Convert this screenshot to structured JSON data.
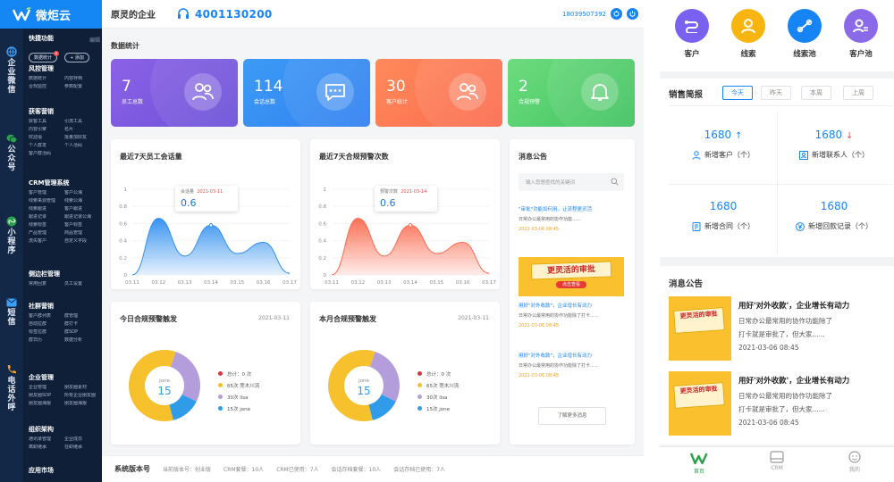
{
  "app": {
    "name": "微炬云"
  },
  "rail": [
    {
      "label": "企业微信",
      "icon": "globe-icon",
      "color": "#3aa0ff"
    },
    {
      "label": "公众号",
      "icon": "wechat-icon",
      "color": "#2aa04a"
    },
    {
      "label": "小程序",
      "icon": "mini-program-icon",
      "color": "#2aa04a"
    },
    {
      "label": "短信",
      "icon": "sms-icon",
      "color": "#3aa0ff"
    },
    {
      "label": "电话外呼",
      "icon": "phone-icon",
      "color": "#f2a118"
    }
  ],
  "sidebar": {
    "quick": {
      "title": "快捷功能",
      "edit": "编辑",
      "pills": [
        "数据统计",
        "+ 添加"
      ]
    },
    "groups": [
      {
        "title": "风控管理",
        "items": [
          "数据统计",
          "内容存档",
          "合规监控",
          "参数配置"
        ]
      },
      {
        "title": "获客营销",
        "items": [
          "获客工具",
          "引流工具",
          "内容引擎",
          "名片",
          "欢迎语",
          "批量加好友",
          "个人群发",
          "个人活码",
          "客户群活码"
        ]
      },
      {
        "title": "CRM管理系统",
        "items": [
          "客户管理",
          "客户公海",
          "线索来源管理",
          "线索公海",
          "线索跟进",
          "客户跟进",
          "跟进记录",
          "跟进记录公海",
          "线索标签",
          "客户标签",
          "产品管理",
          "商品管理",
          "流失客户",
          "自定义字段"
        ]
      },
      {
        "title": "侧边栏管理",
        "items": [
          "常用回复",
          "员工设置"
        ]
      },
      {
        "title": "社群营销",
        "items": [
          "客户群列表",
          "群管理",
          "自动拉群",
          "群打卡",
          "标签拉群",
          "群SOP",
          "群日历",
          "数据分析"
        ]
      },
      {
        "title": "企业管理",
        "items": [
          "企业管理",
          "朋友圈素材",
          "朋友圈SOP",
          "所有企业朋友圈",
          "朋友圈海报",
          "朋友圈海报"
        ]
      },
      {
        "title": "组织架构",
        "items": [
          "通讯录管理",
          "企业成员",
          "离职继承",
          "在职继承"
        ]
      },
      {
        "title": "应用市场",
        "items": []
      }
    ]
  },
  "topbar": {
    "company": "原灵的企业",
    "phone": "4001130200",
    "account": "18039507392"
  },
  "main": {
    "section_title": "数据统计",
    "stats": [
      {
        "value": "7",
        "label": "员工总数",
        "icon": "people-icon",
        "from": "#8c62e6",
        "to": "#6a4fd8"
      },
      {
        "value": "114",
        "label": "会话总数",
        "icon": "chat-icon",
        "from": "#3d9bf5",
        "to": "#2f7ff0"
      },
      {
        "value": "30",
        "label": "客户统计",
        "icon": "people-icon",
        "from": "#ff8a5b",
        "to": "#fb6a4e"
      },
      {
        "value": "2",
        "label": "合规预警",
        "icon": "bell-icon",
        "from": "#6edc7f",
        "to": "#3fc25f"
      }
    ],
    "chart1": {
      "title": "最近7天员工会话量",
      "tooltip_label": "会话量",
      "tooltip_date": "2021-03-11",
      "tooltip_value": "0.6"
    },
    "chart2": {
      "title": "最近7天合规预警次数",
      "tooltip_label": "预警次数",
      "tooltip_date": "2021-03-14",
      "tooltip_value": "0.6"
    },
    "donut1": {
      "title": "今日合规预警触发",
      "date": "2021-03-11",
      "center_name": "jone",
      "center_value": "15"
    },
    "donut2": {
      "title": "本月合规预警触发",
      "date": "2021-03-11",
      "center_name": "jone",
      "center_value": "15"
    },
    "donut_legend": [
      {
        "text": "总计：0 次",
        "color": "#d9363e"
      },
      {
        "text": "65次 莞木川流",
        "color": "#f7c02d"
      },
      {
        "text": "30次 lisa",
        "color": "#b39ddb"
      },
      {
        "text": "15次 jone",
        "color": "#2f9be9"
      }
    ],
    "notice": {
      "title": "消息公告",
      "search_placeholder": "输入您想查找的关键词",
      "news1_title": "\"审批\"功能如何用，让流程更灵活",
      "news1_desc": "日常办公最常用的协作功能......",
      "news1_date": "2021-03-06 08:45",
      "banner_text": "更灵活的审批",
      "banner_sub": "点击查看",
      "news2_title": "用好\"对外收款\"，企业增长有动力",
      "news2_desc": "日常办公最常用的协作功能除了打卡......",
      "news2_date": "2021-03-06 08:45",
      "news3_title": "用好\"对外收款\"，企业增长有动力",
      "news3_desc": "日常办公最常用的协作功能除了打卡......",
      "news3_date": "2021-03-06 08:45",
      "more": "了解更多消息"
    }
  },
  "chart_data": [
    {
      "type": "area",
      "title": "最近7天员工会话量",
      "categories": [
        "03.11",
        "03.12",
        "03.13",
        "03.14",
        "03.15",
        "03.16",
        "03.17"
      ],
      "series": [
        {
          "name": "会话量",
          "values": [
            0.0,
            0.66,
            0.22,
            0.58,
            0.25,
            0.38,
            0.02
          ]
        }
      ],
      "ylim": [
        0,
        1
      ],
      "yticks": [
        "0",
        "0.2",
        "0.4",
        "0.6",
        "0.8",
        "1"
      ],
      "color": "#2f8ef0"
    },
    {
      "type": "area",
      "title": "最近7天合规预警次数",
      "categories": [
        "03.11",
        "03.12",
        "03.13",
        "03.14",
        "03.15",
        "03.16",
        "03.17"
      ],
      "series": [
        {
          "name": "预警次数",
          "values": [
            0.0,
            0.66,
            0.22,
            0.58,
            0.25,
            0.38,
            0.02
          ]
        }
      ],
      "ylim": [
        0,
        1
      ],
      "yticks": [
        "0",
        "0.2",
        "0.4",
        "0.6",
        "0.8",
        "1"
      ],
      "color": "#fb6a4e"
    },
    {
      "type": "pie",
      "title": "今日合规预警触发",
      "categories": [
        "莞木川流",
        "lisa",
        "jone"
      ],
      "values": [
        65,
        30,
        15
      ]
    },
    {
      "type": "pie",
      "title": "本月合规预警触发",
      "categories": [
        "莞木川流",
        "lisa",
        "jone"
      ],
      "values": [
        65,
        30,
        15
      ]
    }
  ],
  "bottom": {
    "title": "系统版本号",
    "items": [
      "当前版本号：创业版",
      "CRM套餐：10人",
      "CRM已使用：7人",
      "会话存档套餐：10人",
      "会话存档已使用：7人"
    ]
  },
  "mobile": {
    "nav": [
      {
        "label": "客户",
        "icon": "link-icon",
        "color": "#7b61f0"
      },
      {
        "label": "线索",
        "icon": "person-icon",
        "color": "#f8b40f"
      },
      {
        "label": "线索池",
        "icon": "chain-icon",
        "color": "#1684f5"
      },
      {
        "label": "客户池",
        "icon": "person-list-icon",
        "color": "#8a6ae8"
      }
    ],
    "sales": {
      "title": "销售简报",
      "tabs": [
        "今天",
        "昨天",
        "本周",
        "上周"
      ],
      "cells": [
        {
          "value": "1680",
          "trend": "↑",
          "label": "新增客户（个）",
          "icon": "user-icon"
        },
        {
          "value": "1680",
          "trend": "↓",
          "label": "新增联系人（个）",
          "icon": "contact-card-icon"
        },
        {
          "value": "1680",
          "trend": "",
          "label": "新增合同（个）",
          "icon": "contract-icon"
        },
        {
          "value": "1680",
          "trend": "",
          "label": "新增回款记录（个）",
          "icon": "yen-icon"
        }
      ]
    },
    "notice": {
      "title": "消息公告",
      "items": [
        {
          "title": "用好'对外收款'，企业增长有动力",
          "line1": "日常办公最常用的协作功能除了",
          "line2": "打卡就是审批了，但大家......",
          "date": "2021-03-06 08:45",
          "thumb": "更灵活的审批"
        },
        {
          "title": "用好'对外收款'，企业增长有动力",
          "line1": "日常办公最常用的协作功能除了",
          "line2": "打卡就是审批了，但大家......",
          "date": "2021-03-06 08:45",
          "thumb": "更灵活的审批"
        }
      ]
    },
    "tabbar": [
      {
        "label": "首页",
        "icon": "home-logo-icon"
      },
      {
        "label": "CRM",
        "icon": "crm-icon"
      },
      {
        "label": "我的",
        "icon": "profile-icon"
      }
    ]
  }
}
